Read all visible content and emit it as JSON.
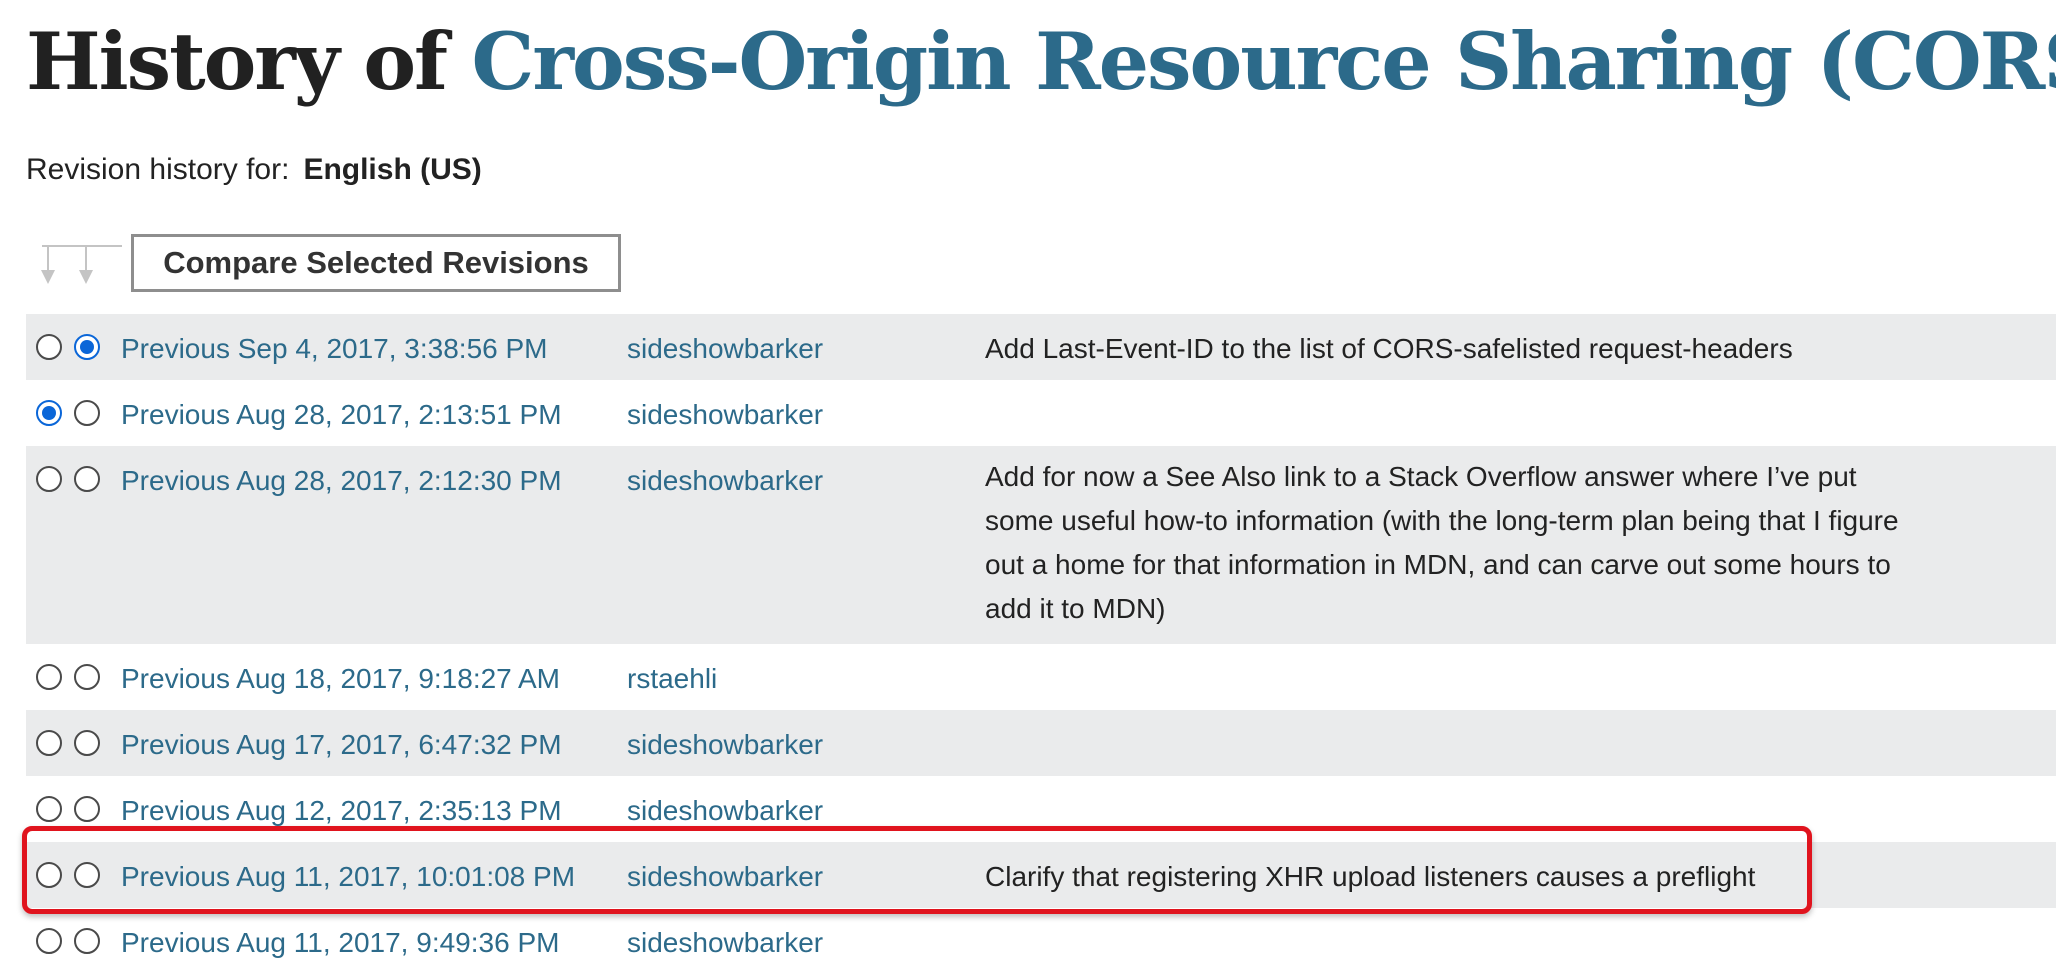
{
  "header": {
    "title_prefix": "History of",
    "title_doc": "Cross-Origin Resource Sharing (CORS)"
  },
  "revision_for": {
    "label": "Revision history for:",
    "locale": "English (US)"
  },
  "toolbar": {
    "compare_label": "Compare Selected Revisions"
  },
  "revisions": [
    {
      "link": "Previous Sep 4, 2017, 3:38:56 PM",
      "author": "sideshowbarker",
      "comment": "Add Last-Event-ID to the list of CORS-safelisted request-headers",
      "from_checked": false,
      "to_checked": true
    },
    {
      "link": "Previous Aug 28, 2017, 2:13:51 PM",
      "author": "sideshowbarker",
      "comment": "",
      "from_checked": true,
      "to_checked": false
    },
    {
      "link": "Previous Aug 28, 2017, 2:12:30 PM",
      "author": "sideshowbarker",
      "comment": "Add for now a See Also link to a Stack Overflow answer where I’ve put some useful how-to information (with the long-term plan being that I figure out a home for that information in MDN, and can carve out some hours to add it to MDN)",
      "from_checked": false,
      "to_checked": false
    },
    {
      "link": "Previous Aug 18, 2017, 9:18:27 AM",
      "author": "rstaehli",
      "comment": "",
      "from_checked": false,
      "to_checked": false
    },
    {
      "link": "Previous Aug 17, 2017, 6:47:32 PM",
      "author": "sideshowbarker",
      "comment": "",
      "from_checked": false,
      "to_checked": false
    },
    {
      "link": "Previous Aug 12, 2017, 2:35:13 PM",
      "author": "sideshowbarker",
      "comment": "",
      "from_checked": false,
      "to_checked": false
    },
    {
      "link": "Previous Aug 11, 2017, 10:01:08 PM",
      "author": "sideshowbarker",
      "comment": "Clarify that registering XHR upload listeners causes a preflight",
      "from_checked": false,
      "to_checked": false
    },
    {
      "link": "Previous Aug 11, 2017, 9:49:36 PM",
      "author": "sideshowbarker",
      "comment": "",
      "from_checked": false,
      "to_checked": false
    }
  ],
  "colors": {
    "link": "#2c6a8a",
    "row_alt_bg": "#eaebec",
    "highlight": "#e0141e",
    "radio_checked": "#0a66d8"
  },
  "icons": {
    "compare_arrows": "down-arrows-icon"
  }
}
